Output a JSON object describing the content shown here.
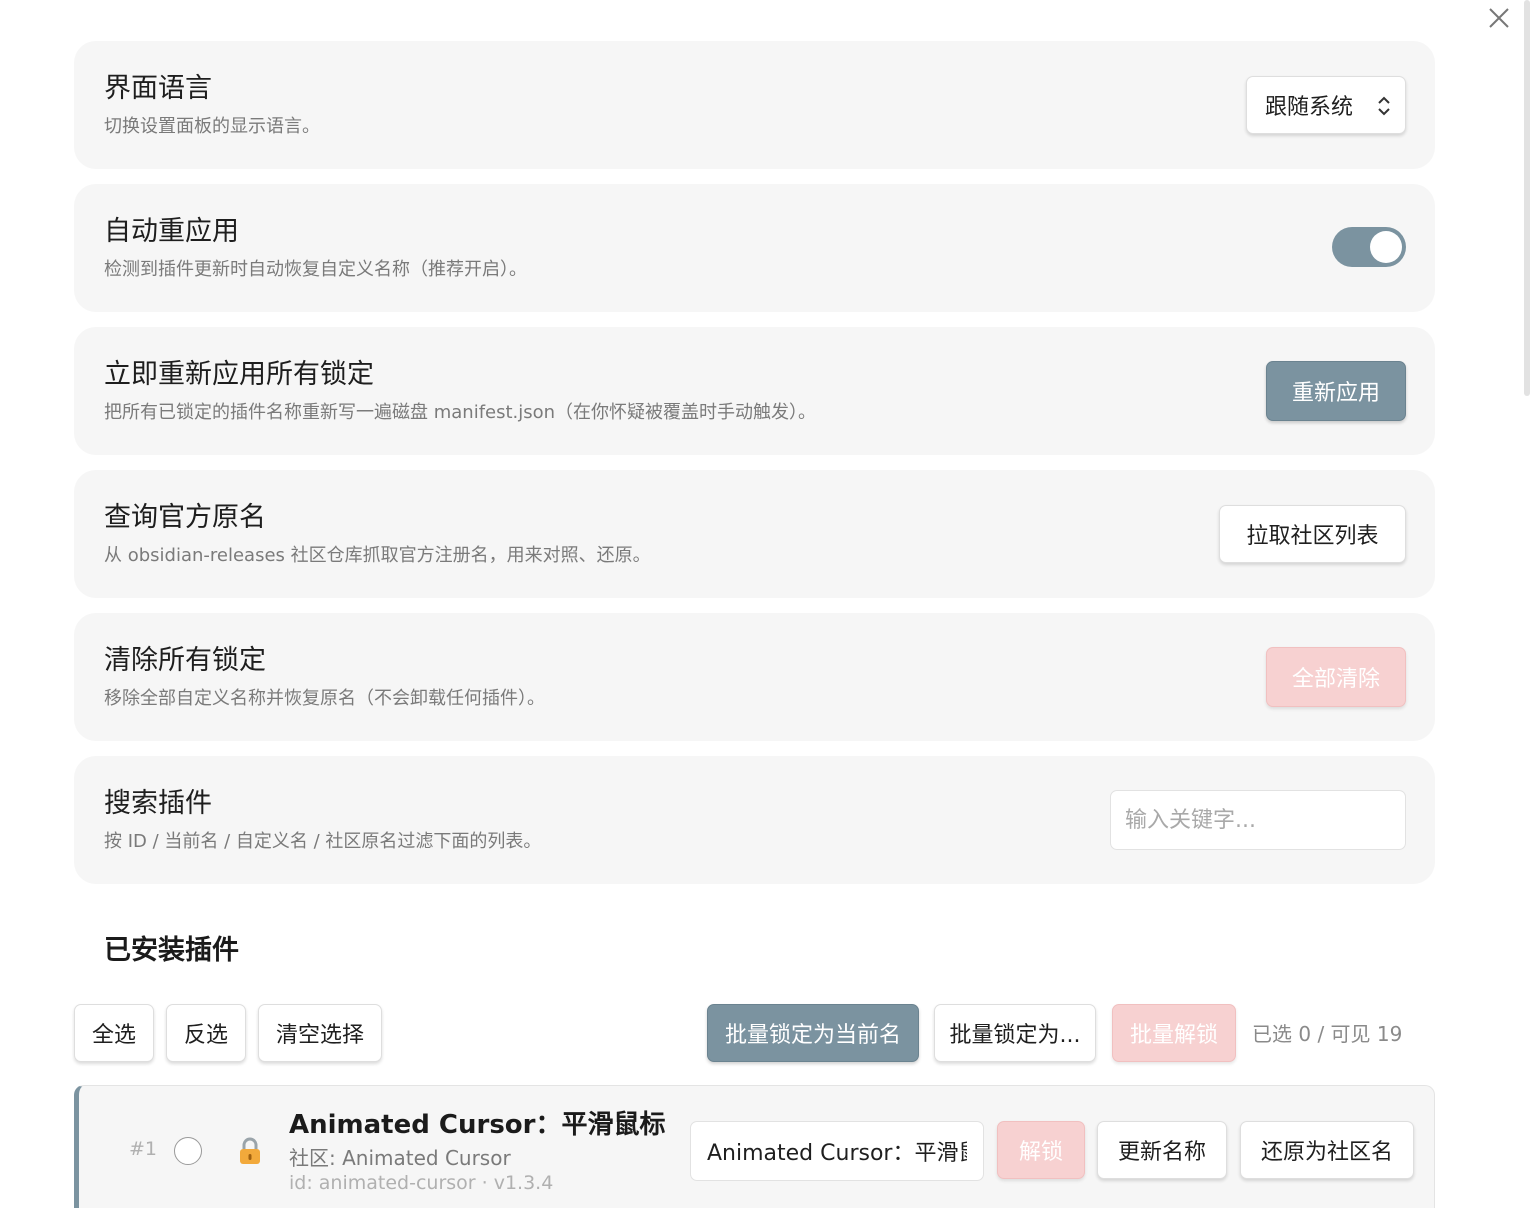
{
  "language": {
    "title": "界面语言",
    "desc": "切换设置面板的显示语言。",
    "selected": "跟随系统"
  },
  "auto_reapply": {
    "title": "自动重应用",
    "desc": "检测到插件更新时自动恢复自定义名称（推荐开启）。",
    "enabled": true
  },
  "reapply_all": {
    "title": "立即重新应用所有锁定",
    "desc": "把所有已锁定的插件名称重新写一遍磁盘 manifest.json（在你怀疑被覆盖时手动触发）。",
    "button": "重新应用"
  },
  "query_names": {
    "title": "查询官方原名",
    "desc": "从 obsidian-releases 社区仓库抓取官方注册名，用来对照、还原。",
    "button": "拉取社区列表"
  },
  "clear_locks": {
    "title": "清除所有锁定",
    "desc": "移除全部自定义名称并恢复原名（不会卸载任何插件）。",
    "button": "全部清除"
  },
  "search": {
    "title": "搜索插件",
    "desc": "按 ID / 当前名 / 自定义名 / 社区原名过滤下面的列表。",
    "placeholder": "输入关键字..."
  },
  "installed": {
    "heading": "已安装插件",
    "select_all": "全选",
    "invert": "反选",
    "clear_selection": "清空选择",
    "batch_lock_current": "批量锁定为当前名",
    "batch_lock_as": "批量锁定为...",
    "batch_unlock": "批量解锁",
    "status": "已选 0 / 可见 19"
  },
  "plugins": [
    {
      "index": "#1",
      "name": "Animated Cursor：平滑鼠标",
      "community": "社区: Animated Cursor",
      "id_line": "id: animated-cursor · v1.3.4",
      "custom_value": "Animated Cursor：平滑鼠标",
      "unlock": "解锁",
      "update": "更新名称",
      "restore": "还原为社区名"
    }
  ],
  "colors": {
    "accent": "#7b93a0",
    "danger_soft": "#f7d1d1",
    "card_bg": "#f6f6f6"
  },
  "icons": [
    "close-icon",
    "chevron-updown-icon",
    "lock-icon"
  ]
}
